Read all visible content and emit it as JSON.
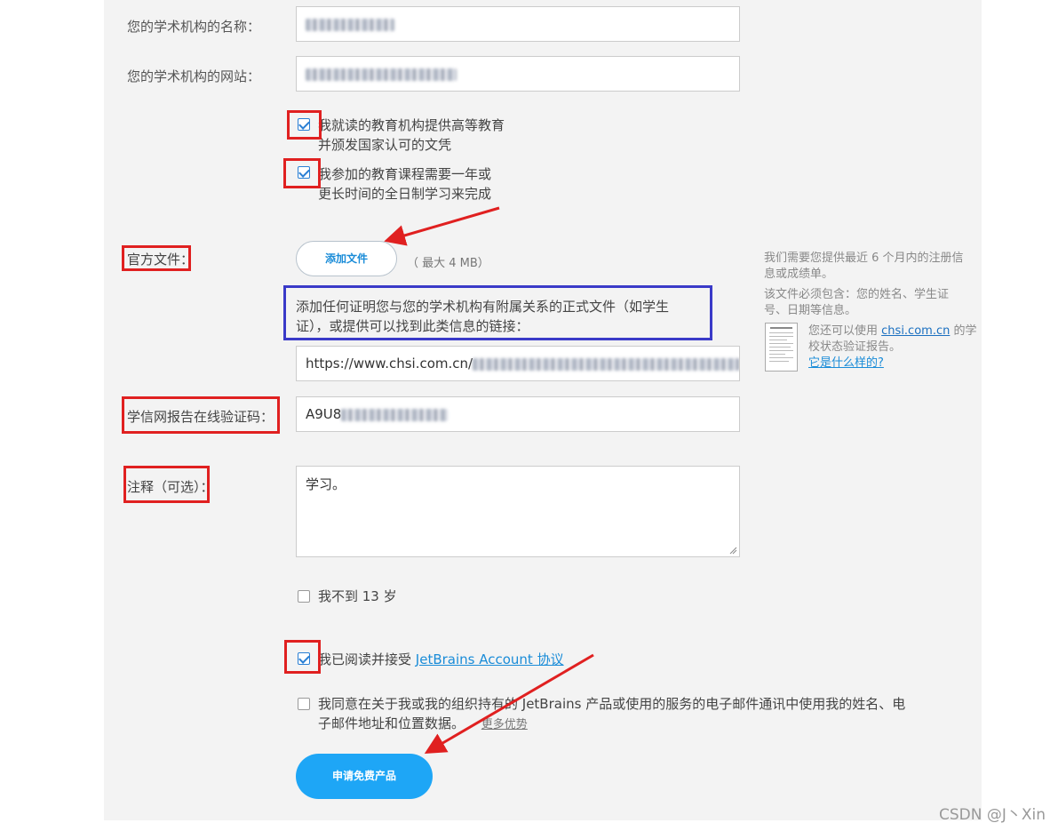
{
  "form": {
    "institution_name_label": "您的学术机构的名称：",
    "institution_site_label": "您的学术机构的网站：",
    "degree_checkbox_line1": "我就读的教育机构提供高等教育",
    "degree_checkbox_line2": "并颁发国家认可的文凭",
    "duration_checkbox_line1": "我参加的教育课程需要一年或",
    "duration_checkbox_line2": "更长时间的全日制学习来完成",
    "official_doc_label": "官方文件：",
    "add_file_button": "添加文件",
    "max_size": "（ 最大 4 MB）",
    "doc_hint_line1": "添加任何证明您与您的学术机构有附属关系的正式文件（如学生",
    "doc_hint_line2": "证），或提供可以找到此类信息的链接：",
    "link_value_visible": "https://www.chsi.com.cn/",
    "verify_code_label": "学信网报告在线验证码：",
    "verify_code_visible": "A9U8",
    "notes_label": "注释（可选）：",
    "notes_value": "学习。",
    "age_checkbox": "我不到 13 岁",
    "agree_text": "我已阅读并接受",
    "agree_link": "JetBrains Account 协议",
    "consent_line1": "我同意在关于我或我的组织持有的 JetBrains 产品或使用的服务的电子邮件通讯中使用我的姓名、电",
    "consent_line2": "子邮件地址和位置数据。",
    "more_benefits_link": "更多优势",
    "submit_button": "申请免费产品"
  },
  "sidebar": {
    "p1_line1": "我们需要您提供最近 6 个月内的注册信",
    "p1_line2": "息或成绩单。",
    "p2_line1": "该文件必须包含：您的姓名、学生证",
    "p2_line2": "号、日期等信息。",
    "p3_line1_prefix": "您还可以使用",
    "p3_link": "chsi.com.cn",
    "p3_line1_suffix": "的学",
    "p3_line2": "校状态验证报告。",
    "p3_what_link": "它是什么样的?"
  },
  "watermark": "CSDN @J丶Xin",
  "colors": {
    "accent": "#1ea6f6",
    "annotation_red": "#e02020",
    "annotation_blue": "#3a3ac8"
  }
}
